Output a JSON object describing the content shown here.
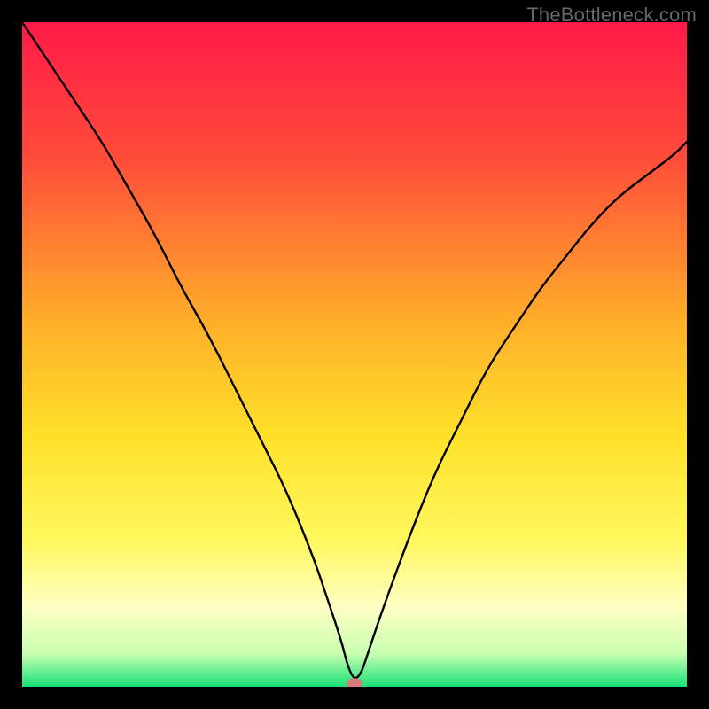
{
  "watermark": "TheBottleneck.com",
  "chart_data": {
    "type": "line",
    "title": "",
    "xlabel": "",
    "ylabel": "",
    "xlim": [
      0,
      100
    ],
    "ylim": [
      0,
      100
    ],
    "background_gradient_stops": [
      {
        "offset": 0,
        "color": "#ff1a48"
      },
      {
        "offset": 20,
        "color": "#ff4b3a"
      },
      {
        "offset": 45,
        "color": "#ffae2a"
      },
      {
        "offset": 62,
        "color": "#ffe029"
      },
      {
        "offset": 78,
        "color": "#fff85e"
      },
      {
        "offset": 88,
        "color": "#ffffc4"
      },
      {
        "offset": 95,
        "color": "#c9ffb0"
      },
      {
        "offset": 100,
        "color": "#18e07a"
      }
    ],
    "series": [
      {
        "name": "bottleneck-curve",
        "color": "#000000",
        "width": 2.4,
        "x": [
          0,
          4,
          8,
          12,
          16,
          20,
          24,
          28,
          32,
          36,
          40,
          44,
          46,
          48,
          49,
          50,
          51,
          52,
          54,
          58,
          62,
          66,
          70,
          74,
          78,
          82,
          86,
          90,
          94,
          98,
          100
        ],
        "y": [
          100,
          94,
          88,
          82,
          75,
          68,
          60,
          53,
          45,
          37,
          29,
          19,
          13,
          7,
          3,
          1,
          2,
          5,
          11,
          22,
          32,
          40,
          48,
          54,
          60,
          65,
          70,
          74,
          77,
          80,
          82
        ]
      }
    ],
    "marker": {
      "name": "optimum-marker",
      "x": 50,
      "y": 0.5,
      "rx": 9,
      "ry": 6,
      "color": "#d97a7a"
    }
  }
}
